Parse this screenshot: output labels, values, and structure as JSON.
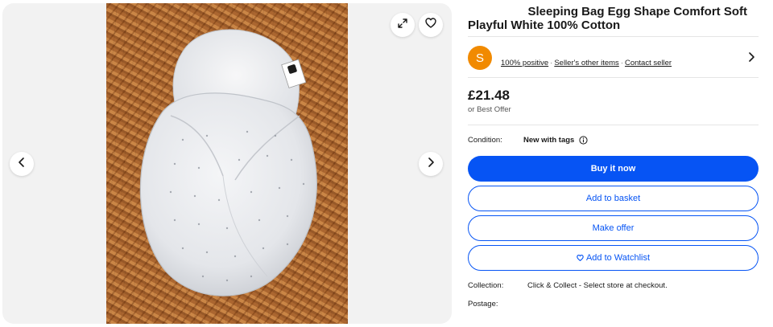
{
  "gallery": {
    "image_alt": "White quilted egg-shaped baby sleeping bag on wooden surface",
    "expand_icon": "expand-icon",
    "watch_icon": "heart-icon",
    "prev_icon": "chevron-left-icon",
    "next_icon": "chevron-right-icon"
  },
  "listing": {
    "title_line1": "Sleeping Bag Egg Shape Comfort Soft",
    "title_line2": "Playful White 100% Cotton"
  },
  "seller": {
    "avatar_letter": "S",
    "avatar_color": "#f18a00",
    "feedback": "100% positive",
    "other_items": "Seller's other items",
    "contact": "Contact seller"
  },
  "pricing": {
    "price": "£21.48",
    "best_offer": "or Best Offer"
  },
  "condition": {
    "label": "Condition:",
    "value": "New with tags"
  },
  "actions": {
    "buy_now": "Buy it now",
    "add_to_basket": "Add to basket",
    "make_offer": "Make offer",
    "add_to_watchlist": "Add to Watchlist",
    "primary_color": "#0654f4"
  },
  "delivery": {
    "collection_label": "Collection:",
    "collection_value": "Click & Collect - Select store at checkout.",
    "postage_label": "Postage:"
  }
}
